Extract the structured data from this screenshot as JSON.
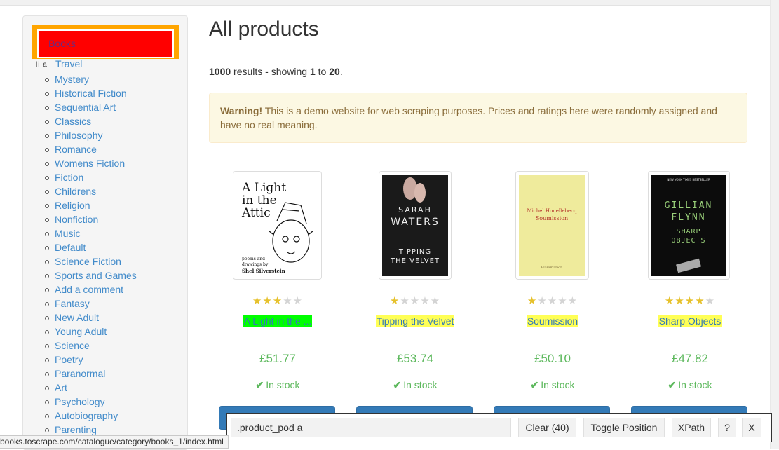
{
  "sidebar": {
    "highlighted_item": "Books",
    "element_label": "li a",
    "partial_item": "Travel",
    "categories": [
      "Mystery",
      "Historical Fiction",
      "Sequential Art",
      "Classics",
      "Philosophy",
      "Romance",
      "Womens Fiction",
      "Fiction",
      "Childrens",
      "Religion",
      "Nonfiction",
      "Music",
      "Default",
      "Science Fiction",
      "Sports and Games",
      "Add a comment",
      "Fantasy",
      "New Adult",
      "Young Adult",
      "Science",
      "Poetry",
      "Paranormal",
      "Art",
      "Psychology",
      "Autobiography",
      "Parenting"
    ]
  },
  "main": {
    "title": "All products",
    "results": {
      "count": "1000",
      "text1": " results - showing ",
      "from": "1",
      "text2": " to ",
      "to": "20",
      "text3": "."
    },
    "warning": {
      "strong": "Warning!",
      "text": " This is a demo website for web scraping purposes. Prices and ratings here were randomly assigned and have no real meaning."
    }
  },
  "products": [
    {
      "title": "A Light in the ...",
      "price": "£51.77",
      "stock": "In stock",
      "rating": 3,
      "highlight": "green"
    },
    {
      "title": "Tipping the Velvet",
      "price": "£53.74",
      "stock": "In stock",
      "rating": 1,
      "highlight": "yellow"
    },
    {
      "title": "Soumission",
      "price": "£50.10",
      "stock": "In stock",
      "rating": 1,
      "highlight": "yellow"
    },
    {
      "title": "Sharp Objects",
      "price": "£47.82",
      "stock": "In stock",
      "rating": 4,
      "highlight": "yellow"
    }
  ],
  "covers": {
    "c1": {
      "line1": "A Light",
      "line2": "in the",
      "line3": "Attic",
      "small1": "poems and",
      "small2": "drawings by",
      "author": "Shel Silverstein"
    },
    "c2": {
      "author1": "SARAH",
      "author2": "WATERS",
      "title1": "TIPPING",
      "title2": "THE VELVET"
    },
    "c3": {
      "author": "Michel Houellebecq",
      "title": "Soumission",
      "publisher": "Flammarion"
    },
    "c4": {
      "tag": "NEW YORK TIMES BESTSELLER",
      "author1": "GILLIAN",
      "author2": "FLYNN",
      "title1": "SHARP",
      "title2": "OBJECTS"
    }
  },
  "selector_toolbar": {
    "query": ".product_pod a",
    "clear_label": "Clear (40)",
    "toggle_label": "Toggle Position",
    "xpath_label": "XPath",
    "help_label": "?",
    "close_label": "X"
  },
  "status_url": "books.toscrape.com/catalogue/category/books_1/index.html",
  "colors": {
    "price": "#5cb85c",
    "link": "#428bca",
    "highlight_yellow": "#ffff55",
    "highlight_green": "#00ff00",
    "selected_red": "#ff0000",
    "selected_orange": "#ffa500"
  }
}
